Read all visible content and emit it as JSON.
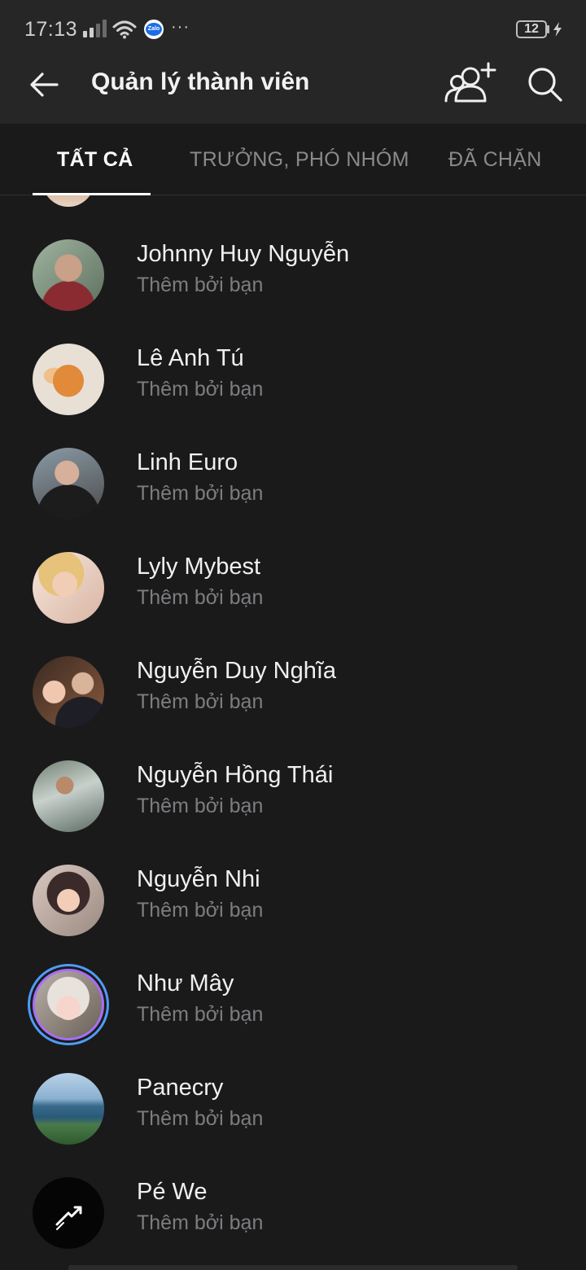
{
  "status_bar": {
    "time": "17:13",
    "more": "···",
    "battery_level": "12",
    "notification_app": "Zalo"
  },
  "header": {
    "title": "Quản lý thành viên",
    "back_icon": "arrow-left-icon",
    "add_icon": "add-member-icon",
    "search_icon": "search-icon"
  },
  "tabs": [
    {
      "label": "TẤT CẢ",
      "active": true
    },
    {
      "label": "TRƯỞNG, PHÓ NHÓM",
      "active": false
    },
    {
      "label": "ĐÃ CHẶN",
      "active": false
    }
  ],
  "members": [
    {
      "name": "Johnny Huy Nguyễn",
      "subtitle": "Thêm bởi bạn"
    },
    {
      "name": "Lê Anh Tú",
      "subtitle": "Thêm bởi bạn"
    },
    {
      "name": "Linh Euro",
      "subtitle": "Thêm bởi bạn"
    },
    {
      "name": "Lyly Mybest",
      "subtitle": "Thêm bởi bạn"
    },
    {
      "name": "Nguyễn Duy Nghĩa",
      "subtitle": "Thêm bởi bạn"
    },
    {
      "name": "Nguyễn Hồng Thái",
      "subtitle": "Thêm bởi bạn"
    },
    {
      "name": "Nguyễn Nhi",
      "subtitle": "Thêm bởi bạn"
    },
    {
      "name": "Như Mây",
      "subtitle": "Thêm bởi bạn"
    },
    {
      "name": "Panecry",
      "subtitle": "Thêm bởi bạn"
    },
    {
      "name": "Pé We",
      "subtitle": "Thêm bởi bạn"
    }
  ],
  "colors": {
    "background": "#1a1a1b",
    "header": "#262627",
    "active_tab": "#ffffff",
    "inactive_tab": "#8a8a8d",
    "subtitle": "#7d7d80",
    "story_ring_start": "#4e9cf5",
    "story_ring_end": "#a86df5"
  }
}
